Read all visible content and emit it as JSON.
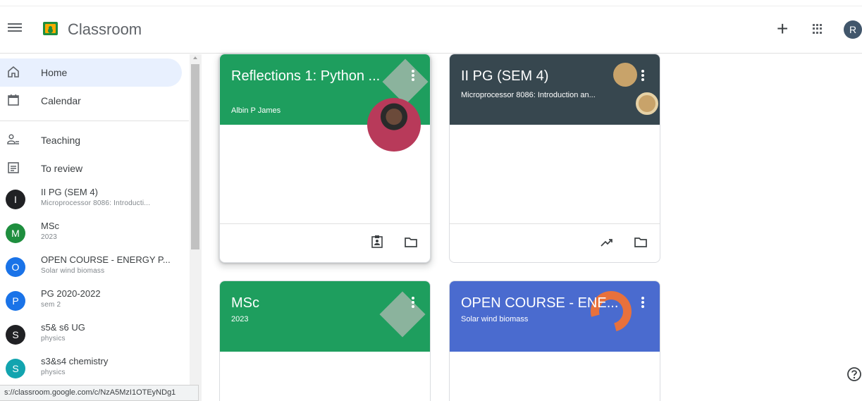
{
  "app": {
    "title": "Classroom",
    "user_initial": "R"
  },
  "sidebar": {
    "nav": [
      {
        "label": "Home",
        "icon": "home-icon"
      },
      {
        "label": "Calendar",
        "icon": "calendar-icon"
      },
      {
        "label": "Teaching",
        "icon": "people-icon"
      },
      {
        "label": "To review",
        "icon": "review-icon"
      }
    ],
    "courses": [
      {
        "initial": "I",
        "title": "II PG (SEM 4)",
        "subtitle": "Microprocessor 8086: Introducti...",
        "color": "#202124"
      },
      {
        "initial": "M",
        "title": "MSc",
        "subtitle": "2023",
        "color": "#1e8e3e"
      },
      {
        "initial": "O",
        "title": "OPEN COURSE - ENERGY P...",
        "subtitle": "Solar wind biomass",
        "color": "#1a73e8"
      },
      {
        "initial": "P",
        "title": "PG 2020-2022",
        "subtitle": "sem 2",
        "color": "#1a73e8"
      },
      {
        "initial": "S",
        "title": "s5& s6 UG",
        "subtitle": "physics",
        "color": "#202124"
      },
      {
        "initial": "S",
        "title": "s3&s4 chemistry",
        "subtitle": "physics",
        "color": "#12a4af"
      }
    ]
  },
  "status_url": "s://classroom.google.com/c/NzA5MzI1OTEyNDg1",
  "cards": [
    {
      "title": "Reflections 1: Python ...",
      "subtitle": "Albin P James",
      "color": "#1e9e5e"
    },
    {
      "title": "II PG (SEM 4)",
      "subtitle": "Microprocessor 8086: Introduction an...",
      "color": "#37474f"
    },
    {
      "title": "MSc",
      "subtitle": "2023",
      "color": "#1e9e5e"
    },
    {
      "title": "OPEN COURSE - ENE...",
      "subtitle": "Solar wind biomass",
      "color": "#4a6bcf"
    }
  ],
  "colors": {
    "active_nav": "#e8f0fe",
    "accent_green": "#1e8e3e"
  }
}
